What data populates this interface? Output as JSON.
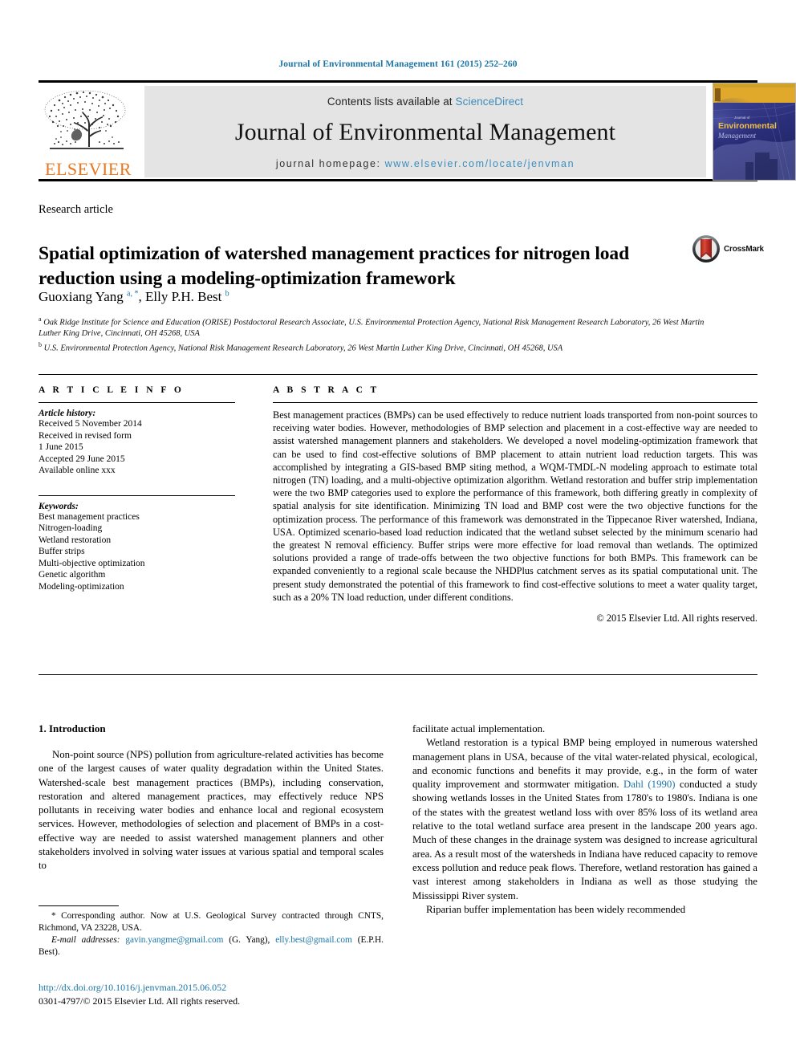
{
  "running_head": "Journal of Environmental Management 161 (2015) 252–260",
  "masthead": {
    "publisher_logo_text": "ELSEVIER",
    "contents_prefix": "Contents lists available at ",
    "contents_link": "ScienceDirect",
    "journal_name": "Journal of Environmental Management",
    "homepage_prefix": "journal homepage: ",
    "homepage_link": "www.elsevier.com/locate/jenvman",
    "cover_title_line1": "Journal of",
    "cover_title_line2": "Environmental",
    "cover_title_line3": "Management",
    "colors": {
      "link_blue": "#3b8dbd",
      "elsevier_orange": "#E87722",
      "band_gray": "#e4e4e4",
      "cover_gold": "#e0a92b",
      "cover_blue": "#2b2f7a"
    }
  },
  "article": {
    "type": "Research article",
    "title": "Spatial optimization of watershed management practices for nitrogen load reduction using a modeling-optimization framework",
    "crossmark_label": "CrossMark",
    "authors_html": "Guoxiang Yang <sup>a</sup><sup class=\"star\">, *</sup>, Elly P.H. Best <sup>b</sup>",
    "affiliation_a": "Oak Ridge Institute for Science and Education (ORISE) Postdoctoral Research Associate, U.S. Environmental Protection Agency, National Risk Management Research Laboratory, 26 West Martin Luther King Drive, Cincinnati, OH 45268, USA",
    "affiliation_b": "U.S. Environmental Protection Agency, National Risk Management Research Laboratory, 26 West Martin Luther King Drive, Cincinnati, OH 45268, USA"
  },
  "article_info": {
    "heading": "A R T I C L E  I N F O",
    "history_label": "Article history:",
    "history": [
      "Received 5 November 2014",
      "Received in revised form",
      "1 June 2015",
      "Accepted 29 June 2015",
      "Available online xxx"
    ],
    "keywords_label": "Keywords:",
    "keywords": [
      "Best management practices",
      "Nitrogen-loading",
      "Wetland restoration",
      "Buffer strips",
      "Multi-objective optimization",
      "Genetic algorithm",
      "Modeling-optimization"
    ]
  },
  "abstract": {
    "heading": "A B S T R A C T",
    "text": "Best management practices (BMPs) can be used effectively to reduce nutrient loads transported from non-point sources to receiving water bodies. However, methodologies of BMP selection and placement in a cost-effective way are needed to assist watershed management planners and stakeholders. We developed a novel modeling-optimization framework that can be used to find cost-effective solutions of BMP placement to attain nutrient load reduction targets. This was accomplished by integrating a GIS-based BMP siting method, a WQM-TMDL-N modeling approach to estimate total nitrogen (TN) loading, and a multi-objective optimization algorithm. Wetland restoration and buffer strip implementation were the two BMP categories used to explore the performance of this framework, both differing greatly in complexity of spatial analysis for site identification. Minimizing TN load and BMP cost were the two objective functions for the optimization process. The performance of this framework was demonstrated in the Tippecanoe River watershed, Indiana, USA. Optimized scenario-based load reduction indicated that the wetland subset selected by the minimum scenario had the greatest N removal efficiency. Buffer strips were more effective for load removal than wetlands. The optimized solutions provided a range of trade-offs between the two objective functions for both BMPs. This framework can be expanded conveniently to a regional scale because the NHDPlus catchment serves as its spatial computational unit. The present study demonstrated the potential of this framework to find cost-effective solutions to meet a water quality target, such as a 20% TN load reduction, under different conditions.",
    "copyright": "© 2015 Elsevier Ltd. All rights reserved."
  },
  "body": {
    "section_heading": "1. Introduction",
    "left_para_1": "Non-point source (NPS) pollution from agriculture-related activities has become one of the largest causes of water quality degradation within the United States. Watershed-scale best management practices (BMPs), including conservation, restoration and altered management practices, may effectively reduce NPS pollutants in receiving water bodies and enhance local and regional ecosystem services. However, methodologies of selection and placement of BMPs in a cost-effective way are needed to assist watershed management planners and other stakeholders involved in solving water issues at various spatial and temporal scales to",
    "right_para_1_cont": "facilitate actual implementation.",
    "right_para_2_a": "Wetland restoration is a typical BMP being employed in numerous watershed management plans in USA, because of the vital water-related physical, ecological, and economic functions and benefits it may provide, e.g., in the form of water quality improvement and stormwater mitigation. ",
    "right_para_2_link": "Dahl (1990)",
    "right_para_2_b": " conducted a study showing wetlands losses in the United States from 1780's to 1980's. Indiana is one of the states with the greatest wetland loss with over 85% loss of its wetland area relative to the total wetland surface area present in the landscape 200 years ago. Much of these changes in the drainage system was designed to increase agricultural area. As a result most of the watersheds in Indiana have reduced capacity to remove excess pollution and reduce peak flows. Therefore, wetland restoration has gained a vast interest among stakeholders in Indiana as well as those studying the Mississippi River system.",
    "right_para_3": "Riparian buffer implementation has been widely recommended"
  },
  "footnotes": {
    "corresponding": "* Corresponding author. Now at U.S. Geological Survey contracted through CNTS, Richmond, VA 23228, USA.",
    "email_label": "E-mail addresses:",
    "email_1": "gavin.yangme@gmail.com",
    "email_1_owner": "(G. Yang)",
    "email_2": "elly.best@gmail.com",
    "email_2_owner": "(E.P.H. Best).",
    "doi": "http://dx.doi.org/10.1016/j.jenvman.2015.06.052",
    "issn_line": "0301-4797/© 2015 Elsevier Ltd. All rights reserved."
  }
}
